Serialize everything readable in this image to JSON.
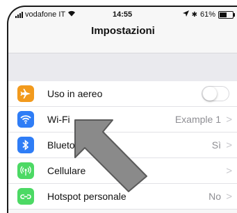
{
  "status_bar": {
    "carrier": "vodafone IT",
    "time": "14:55",
    "battery": "61%",
    "battery_level": 0.61
  },
  "nav": {
    "title": "Impostazioni"
  },
  "settings": [
    {
      "label": "Uso in aereo",
      "icon": "airplane-icon",
      "color": "#f29a1d",
      "toggle": false
    },
    {
      "label": "Wi-Fi",
      "icon": "wifi-icon",
      "color": "#2f7df6",
      "detail": "Example 1",
      "chevron": ">"
    },
    {
      "label": "Blueto",
      "icon": "bluetooth-icon",
      "color": "#2f7df6",
      "detail": "Sì",
      "chevron": ">"
    },
    {
      "label": "Cellulare",
      "icon": "cellular-icon",
      "color": "#4cd964",
      "chevron": ">"
    },
    {
      "label": "Hotspot personale",
      "icon": "hotspot-icon",
      "color": "#4cd964",
      "detail": "No",
      "chevron": ">"
    }
  ],
  "overlay": {
    "arrow_color": "#8a8a8a"
  }
}
